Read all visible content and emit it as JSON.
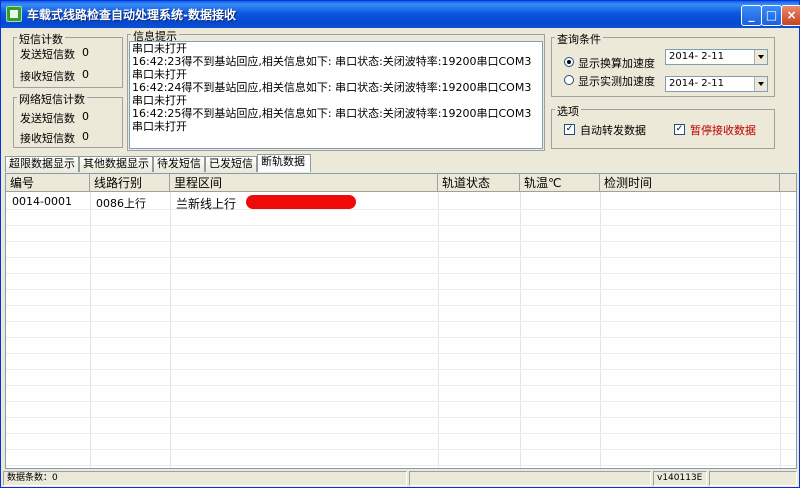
{
  "window": {
    "title": "车载式线路检查自动处理系统-数据接收"
  },
  "sms_counts": {
    "title": "短信计数",
    "sent_label": "发送短信数",
    "sent_value": "0",
    "recv_label": "接收短信数",
    "recv_value": "0"
  },
  "net_counts": {
    "title": "网络短信计数",
    "sent_label": "发送短信数",
    "sent_value": "0",
    "recv_label": "接收短信数",
    "recv_value": "0"
  },
  "info": {
    "title": "信息提示",
    "lines": [
      "串口未打开",
      "16:42:23得不到基站回应,相关信息如下: 串口状态:关闭波特率:19200串口COM3",
      "串口未打开",
      "16:42:24得不到基站回应,相关信息如下: 串口状态:关闭波特率:19200串口COM3",
      "串口未打开",
      "16:42:25得不到基站回应,相关信息如下: 串口状态:关闭波特率:19200串口COM3",
      "串口未打开"
    ]
  },
  "query": {
    "title": "查询条件",
    "option1": "显示换算加速度",
    "option2": "显示实测加速度",
    "date1": "2014- 2-11",
    "date2": "2014- 2-11"
  },
  "options": {
    "title": "选项",
    "auto_forward": "自动转发数据",
    "pause_receive": "暂停接收数据",
    "pause_color": "#c00000"
  },
  "tabs": [
    "超限数据显示",
    "其他数据显示",
    "待发短信",
    "已发短信",
    "断轨数据"
  ],
  "table": {
    "columns": [
      "编号",
      "线路行别",
      "里程区间",
      "轨道状态",
      "轨温℃",
      "检测时间"
    ],
    "rows": [
      [
        "0014-0001",
        "0086上行",
        "兰新线上行",
        "",
        "",
        ""
      ]
    ]
  },
  "status": {
    "record_count": "数据条数：0",
    "version": "v140113E"
  }
}
